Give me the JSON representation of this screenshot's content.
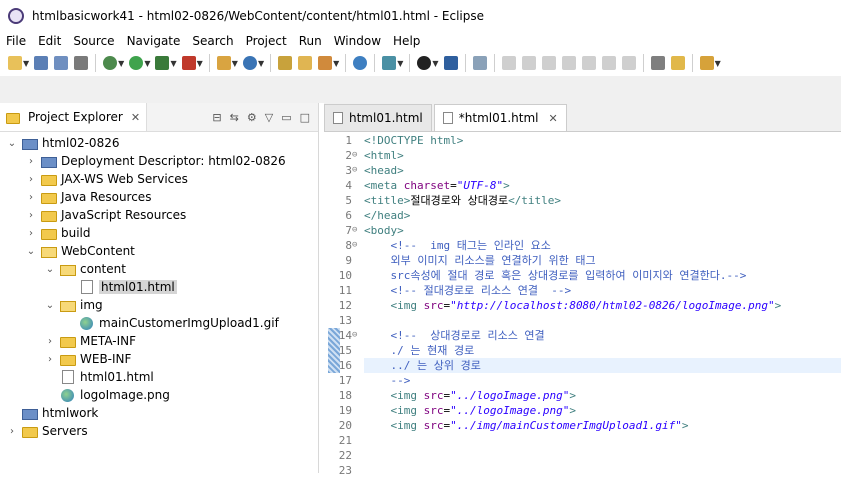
{
  "window": {
    "title": "htmlbasicwork41 - html02-0826/WebContent/content/html01.html - Eclipse"
  },
  "menu": [
    "File",
    "Edit",
    "Source",
    "Navigate",
    "Search",
    "Project",
    "Run",
    "Window",
    "Help"
  ],
  "project_explorer": {
    "tab_label": "Project Explorer",
    "tree": [
      {
        "label": "html02-0826",
        "icon": "project",
        "depth": 0,
        "twisty": "expanded"
      },
      {
        "label": "Deployment Descriptor: html02-0826",
        "icon": "deploy",
        "depth": 1,
        "twisty": "collapsed"
      },
      {
        "label": "JAX-WS Web Services",
        "icon": "ws",
        "depth": 1,
        "twisty": "collapsed"
      },
      {
        "label": "Java Resources",
        "icon": "java",
        "depth": 1,
        "twisty": "collapsed"
      },
      {
        "label": "JavaScript Resources",
        "icon": "js",
        "depth": 1,
        "twisty": "collapsed"
      },
      {
        "label": "build",
        "icon": "folder",
        "depth": 1,
        "twisty": "collapsed"
      },
      {
        "label": "WebContent",
        "icon": "folder-open",
        "depth": 1,
        "twisty": "expanded"
      },
      {
        "label": "content",
        "icon": "folder-open",
        "depth": 2,
        "twisty": "expanded"
      },
      {
        "label": "html01.html",
        "icon": "file",
        "depth": 3,
        "twisty": "none",
        "selected": true
      },
      {
        "label": "img",
        "icon": "folder-open",
        "depth": 2,
        "twisty": "expanded"
      },
      {
        "label": "mainCustomerImgUpload1.gif",
        "icon": "image",
        "depth": 3,
        "twisty": "none"
      },
      {
        "label": "META-INF",
        "icon": "folder",
        "depth": 2,
        "twisty": "collapsed"
      },
      {
        "label": "WEB-INF",
        "icon": "folder",
        "depth": 2,
        "twisty": "collapsed"
      },
      {
        "label": "html01.html",
        "icon": "file",
        "depth": 2,
        "twisty": "none"
      },
      {
        "label": "logoImage.png",
        "icon": "image",
        "depth": 2,
        "twisty": "none"
      },
      {
        "label": "htmlwork",
        "icon": "project",
        "depth": 0,
        "twisty": "none"
      },
      {
        "label": "Servers",
        "icon": "folder",
        "depth": 0,
        "twisty": "collapsed"
      }
    ]
  },
  "editor": {
    "tabs": [
      {
        "label": "html01.html",
        "active": false
      },
      {
        "label": "*html01.html",
        "active": true
      }
    ],
    "lines": [
      {
        "n": "1",
        "fold": "",
        "parts": [
          [
            "tag",
            "<!DOCTYPE html>"
          ]
        ]
      },
      {
        "n": "2",
        "fold": "⊖",
        "parts": [
          [
            "tag",
            "<html>"
          ]
        ]
      },
      {
        "n": "3",
        "fold": "⊖",
        "parts": [
          [
            "tag",
            "<head>"
          ]
        ]
      },
      {
        "n": "4",
        "fold": "",
        "parts": [
          [
            "tag",
            "<meta "
          ],
          [
            "attr",
            "charset"
          ],
          [
            "ctext",
            "="
          ],
          [
            "val",
            "\"UTF-8\""
          ],
          [
            "tag",
            ">"
          ]
        ]
      },
      {
        "n": "5",
        "fold": "",
        "parts": [
          [
            "tag",
            "<title>"
          ],
          [
            "ctext",
            "절대경로와 상대경로"
          ],
          [
            "tag",
            "</title>"
          ]
        ]
      },
      {
        "n": "6",
        "fold": "",
        "parts": [
          [
            "tag",
            "</head>"
          ]
        ]
      },
      {
        "n": "7",
        "fold": "⊖",
        "parts": [
          [
            "tag",
            "<body>"
          ]
        ]
      },
      {
        "n": "8",
        "fold": "⊖",
        "parts": [
          [
            "cmt",
            "    <!--  img 태그는 인라인 요소"
          ]
        ]
      },
      {
        "n": "9",
        "fold": "",
        "parts": [
          [
            "cmt",
            "    외부 이미지 리소스를 연결하기 위한 태그"
          ]
        ]
      },
      {
        "n": "10",
        "fold": "",
        "parts": [
          [
            "cmt",
            "    src속성에 절대 경로 혹은 상대경로를 입력하여 이미지와 연결한다.-->"
          ]
        ]
      },
      {
        "n": "11",
        "fold": "",
        "parts": [
          [
            "cmt",
            "    <!-- 절대경로로 리소스 연결  -->"
          ]
        ]
      },
      {
        "n": "12",
        "fold": "",
        "parts": [
          [
            "tag",
            "    <img "
          ],
          [
            "attr",
            "src"
          ],
          [
            "ctext",
            "="
          ],
          [
            "val",
            "\"http://localhost:8080/html02-0826/logoImage.png\""
          ],
          [
            "tag",
            ">"
          ]
        ]
      },
      {
        "n": "13",
        "fold": "",
        "parts": []
      },
      {
        "n": "14",
        "fold": "⊖",
        "parts": [
          [
            "cmt",
            "    <!--  상대경로로 리소스 연결"
          ]
        ]
      },
      {
        "n": "15",
        "fold": "",
        "parts": [
          [
            "cmt",
            "    ./ 는 현재 경로"
          ]
        ]
      },
      {
        "n": "16",
        "fold": "",
        "parts": [
          [
            "cmt",
            "    ../ 는 상위 경로"
          ]
        ]
      },
      {
        "n": "17",
        "fold": "",
        "parts": [
          [
            "cmt",
            "    -->"
          ]
        ]
      },
      {
        "n": "18",
        "fold": "",
        "parts": [
          [
            "tag",
            "    <img "
          ],
          [
            "attr",
            "src"
          ],
          [
            "ctext",
            "="
          ],
          [
            "val",
            "\"../logoImage.png\""
          ],
          [
            "tag",
            ">"
          ]
        ]
      },
      {
        "n": "19",
        "fold": "",
        "parts": [
          [
            "tag",
            "    <img "
          ],
          [
            "attr",
            "src"
          ],
          [
            "ctext",
            "="
          ],
          [
            "val",
            "\"../logoImage.png\""
          ],
          [
            "tag",
            ">"
          ]
        ]
      },
      {
        "n": "20",
        "fold": "",
        "parts": [
          [
            "tag",
            "    <img "
          ],
          [
            "attr",
            "src"
          ],
          [
            "ctext",
            "="
          ],
          [
            "val",
            "\"../img/mainCustomerImgUpload1.gif\""
          ],
          [
            "tag",
            ">"
          ]
        ]
      },
      {
        "n": "21",
        "fold": "",
        "parts": []
      },
      {
        "n": "22",
        "fold": "",
        "parts": []
      },
      {
        "n": "23",
        "fold": "",
        "parts": []
      }
    ],
    "current_line": "16"
  }
}
